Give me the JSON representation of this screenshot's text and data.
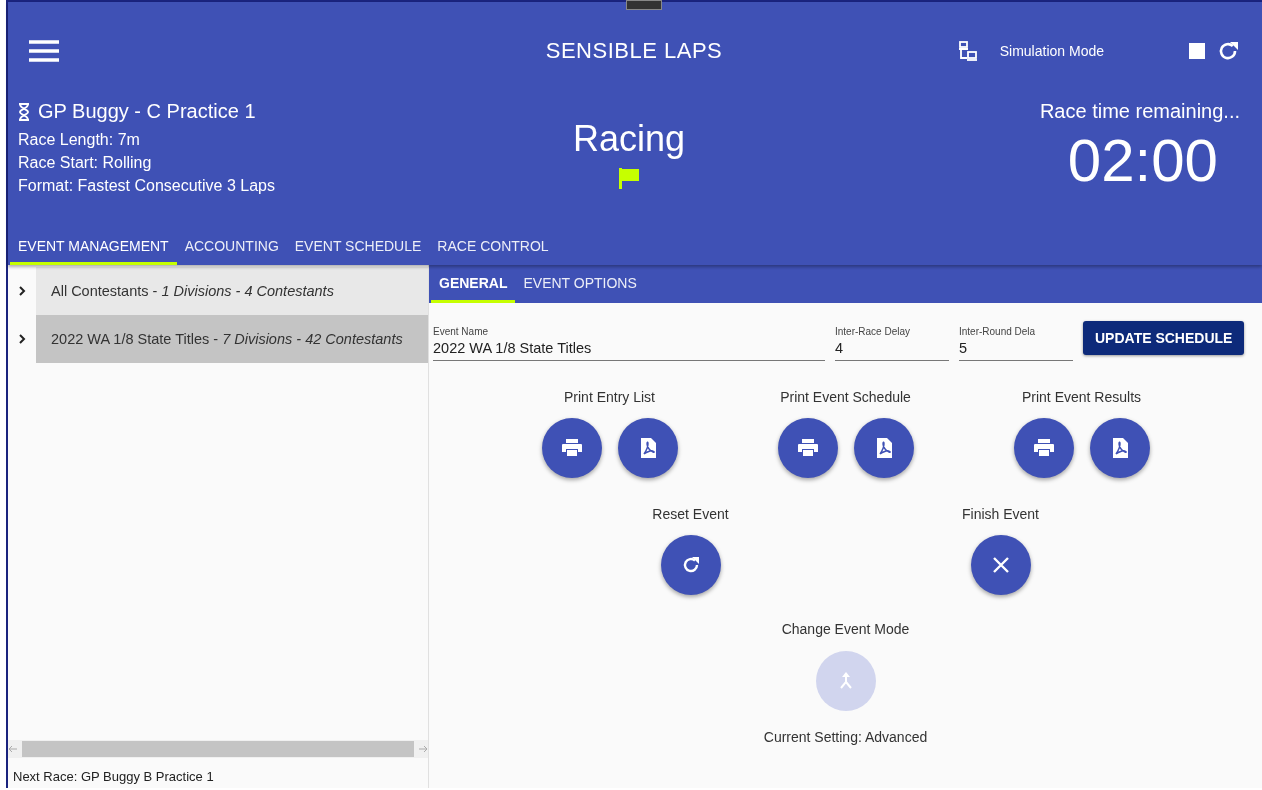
{
  "app": {
    "title": "SENSIBLE LAPS",
    "mode_label": "Simulation Mode"
  },
  "race": {
    "name": "GP Buggy - C Practice 1",
    "details": [
      "Race Length: 7m",
      "Race Start: Rolling",
      "Format: Fastest Consecutive 3 Laps"
    ],
    "status": "Racing",
    "countdown_label": "Race time remaining...",
    "countdown": "02:00"
  },
  "main_tabs": [
    {
      "label": "EVENT MANAGEMENT",
      "selected": true
    },
    {
      "label": "ACCOUNTING",
      "selected": false
    },
    {
      "label": "EVENT SCHEDULE",
      "selected": false
    },
    {
      "label": "RACE CONTROL",
      "selected": false
    }
  ],
  "tree": {
    "items": [
      {
        "label": "All Contestants - *1 Divisions - 4 Contestants*",
        "selected": false,
        "expanded": false
      },
      {
        "label": "2022 WA 1/8 State Titles - *7 Divisions - 42 Contestants*",
        "selected": true,
        "expanded": false
      }
    ]
  },
  "sub_tabs": [
    {
      "label": "GENERAL",
      "selected": true
    },
    {
      "label": "EVENT OPTIONS",
      "selected": false
    }
  ],
  "form": {
    "fields": [
      {
        "label": "Event Name",
        "value": "2022 WA 1/8 State Titles"
      },
      {
        "label": "Inter-Race Delay",
        "value": "4"
      },
      {
        "label": "Inter-Round Dela",
        "value": "5"
      }
    ],
    "button": "UPDATE SCHEDULE"
  },
  "print_groups": [
    {
      "label": "Print Entry List",
      "buttons": [
        {
          "kind": "print"
        },
        {
          "kind": "pdf"
        }
      ]
    },
    {
      "label": "Print Event Schedule",
      "buttons": [
        {
          "kind": "print"
        },
        {
          "kind": "pdf"
        }
      ]
    },
    {
      "label": "Print Event Results",
      "buttons": [
        {
          "kind": "print"
        },
        {
          "kind": "pdf"
        }
      ]
    }
  ],
  "event_actions": [
    {
      "label": "Reset Event",
      "kind": "reset"
    },
    {
      "label": "Finish Event",
      "kind": "finish"
    }
  ],
  "mode_action": {
    "label": "Change Event Mode",
    "kind": "merge",
    "disabled": true,
    "setting": "Current Setting: Advanced"
  },
  "footer": {
    "next_race": "Next Race: GP Buggy B Practice 1"
  }
}
